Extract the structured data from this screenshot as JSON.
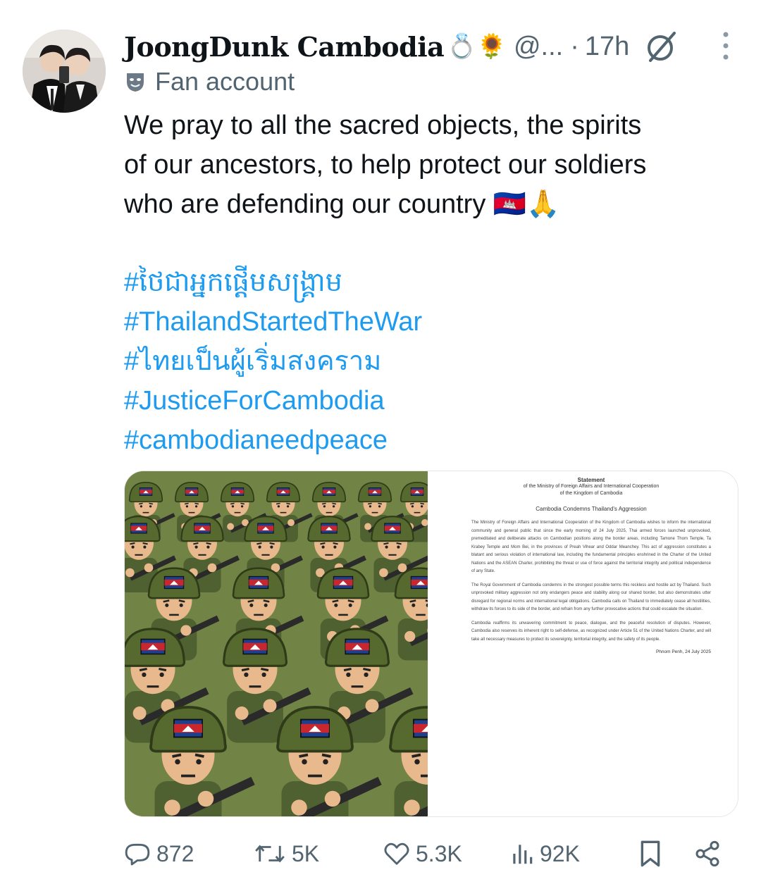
{
  "tweet": {
    "display_name": "JoongDunk Cambodia",
    "name_emojis": "💍🌻",
    "handle": "@...",
    "separator": "·",
    "time": "17h",
    "badge_label": "Fan account",
    "text_lines": [
      "We pray to all the sacred objects, the spirits",
      "of our ancestors, to help protect our soldiers",
      "who are defending our country 🇰🇭🙏"
    ],
    "hashtags": [
      "#ថៃជាអ្នកផ្តើមសង្គ្រាម",
      "#ThailandStartedTheWar",
      "#ไทยเป็นผู้เริ่มสงคราม",
      "#JusticeForCambodia",
      "#cambodianeedpeace"
    ]
  },
  "statement": {
    "title": "Statement",
    "subtitle_1": "of the Ministry of Foreign Affairs and International Cooperation",
    "subtitle_2": "of the Kingdom of Cambodia",
    "heading": "Cambodia Condemns Thailand's Aggression",
    "paragraphs": [
      "The Ministry of Foreign Affairs and International Cooperation of the Kingdom of Cambodia wishes to inform the international community and general public that since the early morning of 24 July 2025, Thai armed forces launched unprovoked, premeditated and deliberate attacks on Cambodian positions along the border areas, including Tamone Thom Temple, Ta Krabey Temple and Mom Bei, in the provinces of Preah Vihear and Oddar Meanchey. This act of aggression constitutes a blatant and serious violation of international law, including the fundamental principles enshrined in the Charter of the United Nations and the ASEAN Charter, prohibiting the threat or use of force against the territorial integrity and political independence of any State.",
      "The Royal Government of Cambodia condemns in the strongest possible terms this reckless and hostile act by Thailand. Such unprovoked military aggression not only endangers peace and stability along our shared border, but also demonstrates utter disregard for regional norms and international legal obligations. Cambodia calls on Thailand to immediately cease all hostilities, withdraw its forces to its side of the border, and refrain from any further provocative actions that could escalate the situation.",
      "Cambodia reaffirms its unwavering commitment to peace, dialogue, and the peaceful resolution of disputes. However, Cambodia also reserves its inherent right to self-defense, as recognized under Article 51 of the United Nations Charter, and will take all necessary measures to protect its sovereignty, territorial integrity, and the safety of its people."
    ],
    "date": "Phnom Penh, 24 July 2025"
  },
  "actions": {
    "replies": "872",
    "reposts": "5K",
    "likes": "5.3K",
    "views": "92K"
  },
  "colors": {
    "text": "#0f1419",
    "secondary": "#536471",
    "link": "#1d9bf0",
    "uniform": "#5c6e2f"
  },
  "icons": [
    "reply-icon",
    "repost-icon",
    "like-icon",
    "views-icon",
    "bookmark-icon",
    "share-icon",
    "grok-icon",
    "more-icon",
    "badge-mask-icon"
  ]
}
